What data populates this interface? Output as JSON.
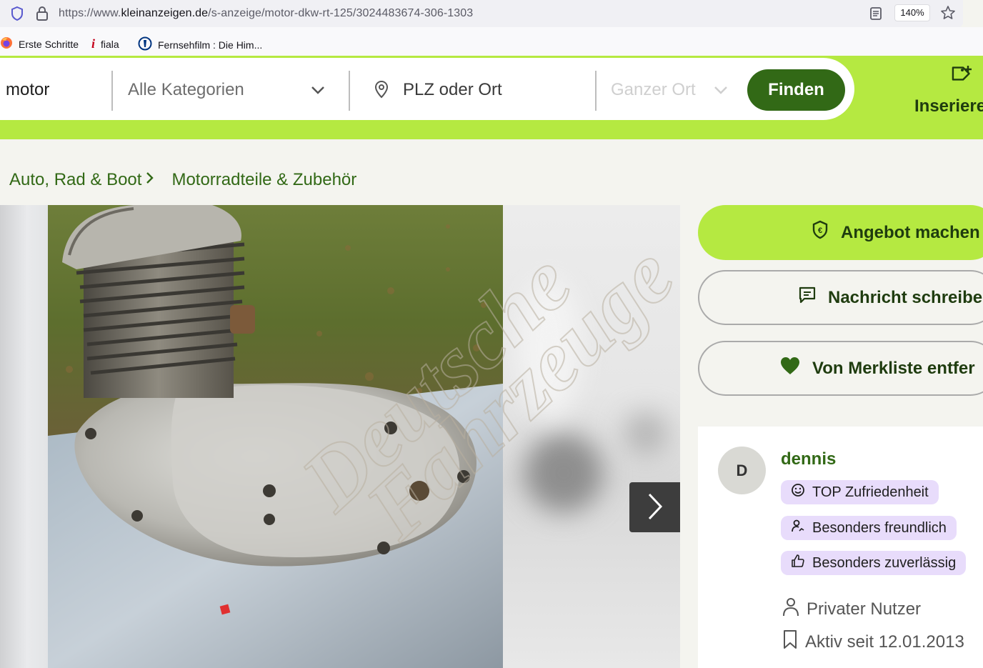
{
  "browser": {
    "url_prefix": "https://www.",
    "url_domain": "kleinanzeigen.de",
    "url_path": "/s-anzeige/motor-dkw-rt-125/3024483674-306-1303",
    "zoom": "140%",
    "bookmarks": [
      {
        "label": "Erste Schritte",
        "icon": "firefox-icon"
      },
      {
        "label": "fiala",
        "icon": "info-icon"
      },
      {
        "label": "Fernsehfilm : Die Him...",
        "icon": "ard-icon"
      }
    ]
  },
  "search": {
    "query": "motor",
    "category": "Alle Kategorien",
    "location_placeholder": "PLZ oder Ort",
    "radius": "Ganzer Ort",
    "find_label": "Finden"
  },
  "header": {
    "post_label": "Inseriere"
  },
  "breadcrumb": {
    "items": [
      "Auto, Rad & Boot",
      "Motorradteile & Zubehör"
    ]
  },
  "actions": {
    "offer_label": "Angebot machen",
    "message_label": "Nachricht schreibe",
    "watchlist_label": "Von Merkliste entfer"
  },
  "seller": {
    "initial": "D",
    "name": "dennis",
    "badges": [
      {
        "label": "TOP Zufriedenheit",
        "icon": "smiley-icon"
      },
      {
        "label": "Besonders freundlich",
        "icon": "person-wave-icon"
      },
      {
        "label": "Besonders zuverlässig",
        "icon": "thumbs-up-icon"
      }
    ],
    "type": "Privater Nutzer",
    "active_since": "Aktiv seit 12.01.2013"
  },
  "watermark": {
    "line1": "Deutsche",
    "line2": "Fahrzeuge"
  },
  "colors": {
    "brand_green": "#b5e941",
    "dark_green": "#326916",
    "badge_purple": "#e8dcfb"
  }
}
